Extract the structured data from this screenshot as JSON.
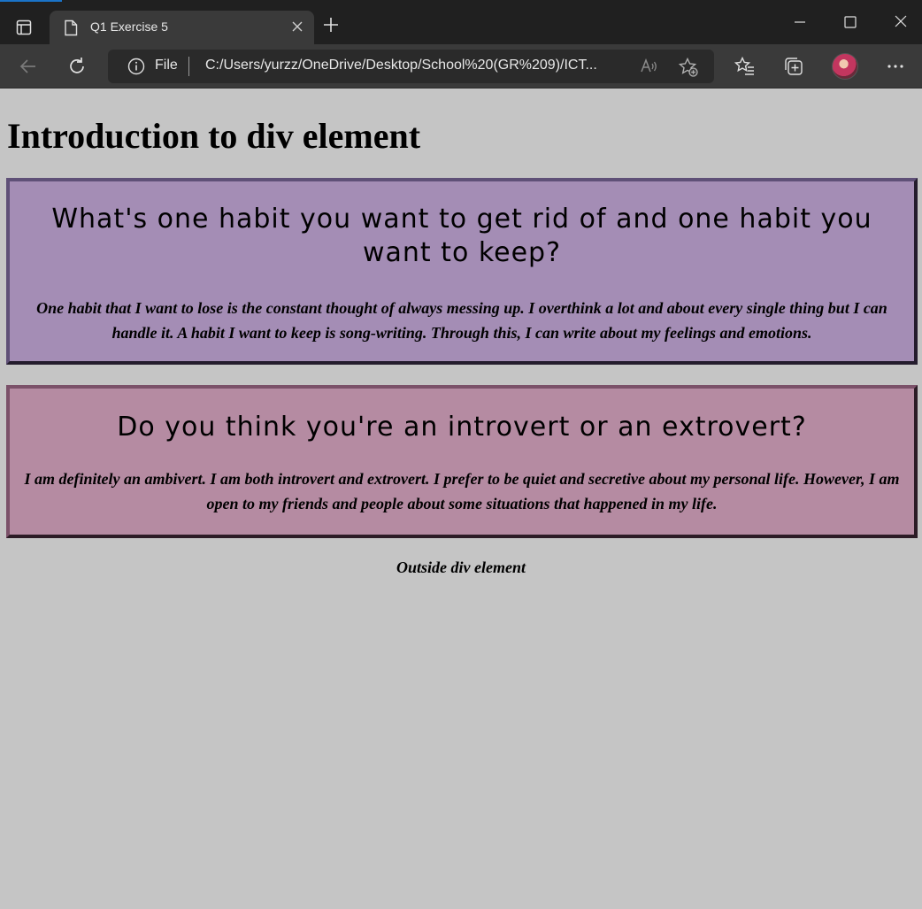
{
  "browser": {
    "tab_title": "Q1 Exercise 5",
    "address": {
      "protocol": "File",
      "url": "C:/Users/yurzz/OneDrive/Desktop/School%20(GR%209)/ICT..."
    }
  },
  "page": {
    "heading": "Introduction to div element",
    "divs": [
      {
        "question": "What's one habit you want to get rid of and one habit you want to keep?",
        "answer": "One habit that I want to lose is the constant thought of always messing up. I overthink a lot and about every single thing but I can handle it. A habit I want to keep is song-writing. Through this, I can write about my feelings and emotions.",
        "background": "#a48db5"
      },
      {
        "question": "Do you think you're an introvert or an extrovert?",
        "answer": "I am definitely an ambivert. I am both introvert and extrovert. I prefer to be quiet and secretive about my personal life. However, I am open to my friends and people about some situations that happened in my life.",
        "background": "#b58ba2"
      }
    ],
    "outside_text": "Outside div element",
    "background": "#c5c5c5"
  }
}
